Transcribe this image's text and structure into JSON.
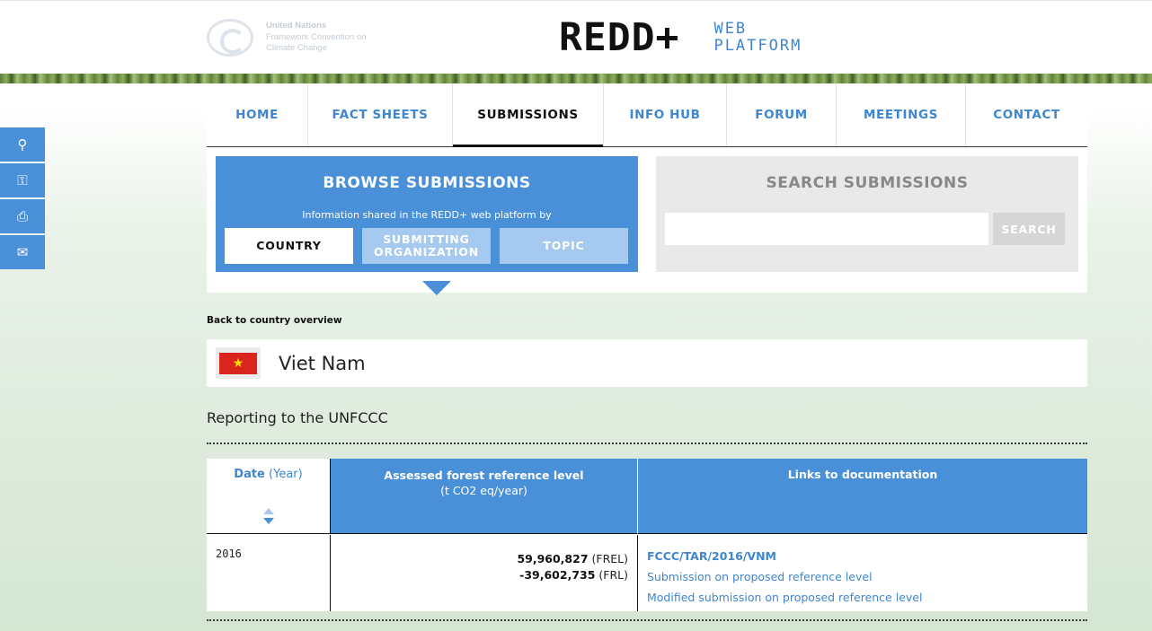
{
  "header": {
    "un_line1": "United Nations",
    "un_line2": "Framework Convention on",
    "un_line3": "Climate Change",
    "brand_main": "REDD+",
    "brand_sub_1": "WEB",
    "brand_sub_2": "PLATFORM"
  },
  "side_tools": [
    {
      "icon": "search-icon",
      "glyph": "⚲"
    },
    {
      "icon": "key-icon",
      "glyph": "⚿"
    },
    {
      "icon": "print-icon",
      "glyph": "⎙"
    },
    {
      "icon": "mail-icon",
      "glyph": "✉"
    }
  ],
  "nav": {
    "items": [
      {
        "label": "HOME",
        "active": false
      },
      {
        "label": "FACT SHEETS",
        "active": false
      },
      {
        "label": "SUBMISSIONS",
        "active": true
      },
      {
        "label": "INFO HUB",
        "active": false
      },
      {
        "label": "FORUM",
        "active": false
      },
      {
        "label": "MEETINGS",
        "active": false
      },
      {
        "label": "CONTACT",
        "active": false
      }
    ]
  },
  "browse": {
    "title": "BROWSE SUBMISSIONS",
    "subtitle": "Information shared in the REDD+ web platform by",
    "tabs": [
      {
        "label": "COUNTRY",
        "active": true
      },
      {
        "label": "SUBMITTING ORGANIZATION",
        "active": false
      },
      {
        "label": "TOPIC",
        "active": false
      }
    ]
  },
  "search": {
    "title": "SEARCH SUBMISSIONS",
    "input_value": "",
    "button_label": "SEARCH"
  },
  "back_link": "Back to country overview",
  "country": {
    "name": "Viet Nam",
    "flag_colors": {
      "field": "#da251d",
      "star": "#ffde00"
    }
  },
  "section_title": "Reporting to the UNFCCC",
  "table": {
    "col_date_label": "Date",
    "col_date_sub": "(Year)",
    "col_frl_line1": "Assessed forest reference level",
    "col_frl_line2": "(t CO2 eq/year)",
    "col_links": "Links to documentation",
    "rows": [
      {
        "date": "2016",
        "frel_value": "59,960,827",
        "frel_tag": "(FREL)",
        "frl_value": "-39,602,735",
        "frl_tag": "(FRL)",
        "links": [
          "FCCC/TAR/2016/VNM",
          "Submission on proposed reference level",
          "Modified submission on proposed reference level"
        ]
      }
    ]
  },
  "colors": {
    "accent_blue": "#4a90d9",
    "link_blue": "#3e86cf",
    "light_blue": "#a6c9ef"
  }
}
